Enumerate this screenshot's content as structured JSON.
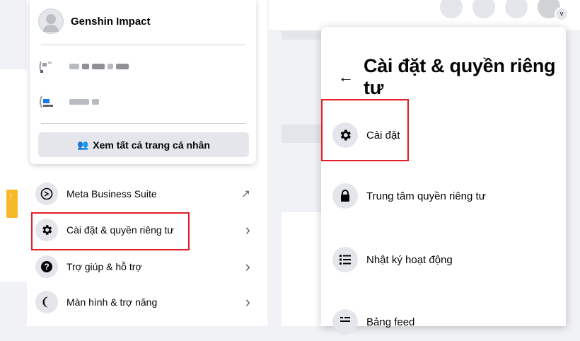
{
  "profile_menu": {
    "main_profile_name": "Genshin Impact",
    "see_all_profiles": "Xem tất cả trang cá nhân",
    "items": [
      {
        "label": "Meta Business Suite",
        "icon": "meta-business-icon",
        "trailing": "↗"
      },
      {
        "label": "Cài đặt & quyền riêng tư",
        "icon": "gear-icon",
        "trailing": "›"
      },
      {
        "label": "Trợ giúp & hỗ trợ",
        "icon": "help-icon",
        "trailing": "›"
      },
      {
        "label": "Màn hình & trợ năng",
        "icon": "moon-icon",
        "trailing": "›"
      }
    ]
  },
  "settings_panel": {
    "back_icon": "←",
    "title": "Cài đặt & quyền riêng tư",
    "items": [
      {
        "label": "Cài đặt",
        "icon": "gear-icon"
      },
      {
        "label": "Trung tâm quyền riêng tư",
        "icon": "lock-icon"
      },
      {
        "label": "Nhật ký hoạt động",
        "icon": "list-icon"
      },
      {
        "label": "Bảng feed",
        "icon": "feed-icon"
      }
    ]
  },
  "colors": {
    "highlight": "#e41e26",
    "icon_bg": "#e4e6eb"
  }
}
